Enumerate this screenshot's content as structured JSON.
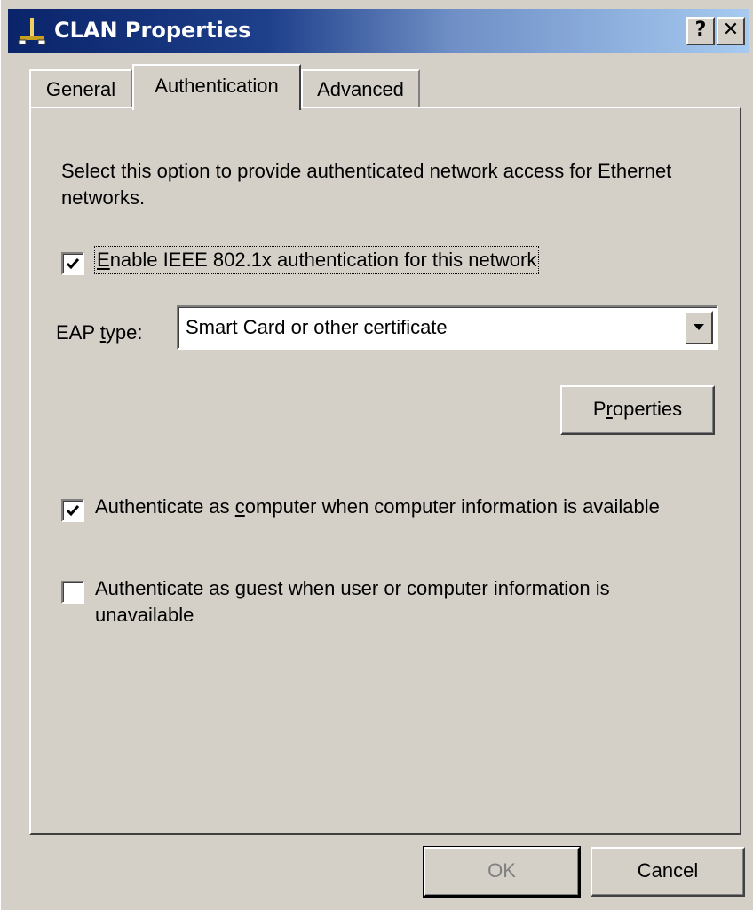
{
  "window": {
    "title": "CLAN Properties",
    "icon": "network-connection-icon",
    "help_label": "?",
    "close_label": "✕"
  },
  "tabs": [
    {
      "label": "General",
      "active": false
    },
    {
      "label": "Authentication",
      "active": true
    },
    {
      "label": "Advanced",
      "active": false
    }
  ],
  "auth": {
    "description": "Select this option to provide authenticated network access for Ethernet networks.",
    "enable": {
      "pre": "",
      "accel": "E",
      "post": "nable IEEE 802.1x authentication for this network",
      "checked": true
    },
    "eap": {
      "pre": "EAP ",
      "accel": "t",
      "post": "ype:",
      "value": "Smart Card or other certificate"
    },
    "properties_button": {
      "pre": "P",
      "accel": "r",
      "post": "operties"
    },
    "auth_computer": {
      "pre": "Authenticate as ",
      "accel": "c",
      "post": "omputer when computer information is available",
      "checked": true
    },
    "auth_guest": {
      "pre": "Authenticate as ",
      "accel": "g",
      "post": "uest when user or computer information is unavailable",
      "checked": false
    }
  },
  "footer": {
    "ok_label": "OK",
    "cancel_label": "Cancel"
  }
}
